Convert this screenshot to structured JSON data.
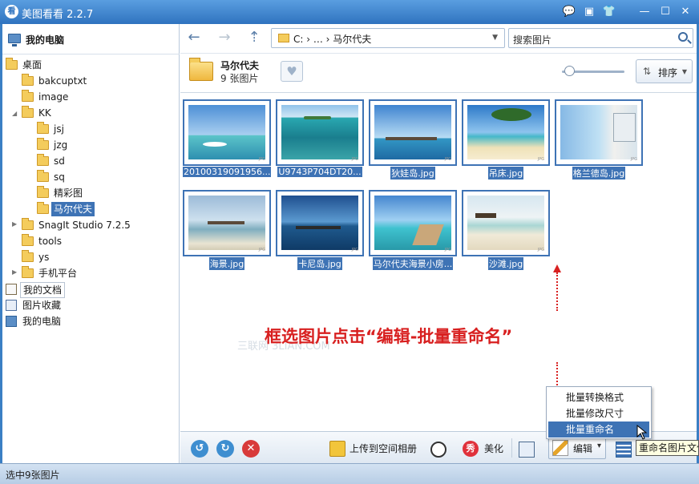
{
  "window": {
    "logo_char": "看",
    "title": "美图看看 2.2.7",
    "buttons": [
      "💬",
      "▣",
      "👕",
      "—",
      "☐",
      "✕"
    ]
  },
  "tree": {
    "header": "我的电脑",
    "items": [
      {
        "label": "桌面",
        "level": 0
      },
      {
        "label": "bakcuptxt",
        "level": 1
      },
      {
        "label": "image",
        "level": 1
      },
      {
        "label": "KK",
        "level": 1
      },
      {
        "label": "jsj",
        "level": 2
      },
      {
        "label": "jzg",
        "level": 2
      },
      {
        "label": "sd",
        "level": 2
      },
      {
        "label": "sq",
        "level": 2
      },
      {
        "label": "精彩图",
        "level": 2
      },
      {
        "label": "马尔代夫",
        "level": 2,
        "selected": true
      },
      {
        "label": "SnagIt Studio 7.2.5",
        "level": 1
      },
      {
        "label": "tools",
        "level": 1
      },
      {
        "label": "ys",
        "level": 1
      },
      {
        "label": "手机平台",
        "level": 1
      },
      {
        "label": "我的文档",
        "level": 0
      },
      {
        "label": "图片收藏",
        "level": 0
      },
      {
        "label": "我的电脑",
        "level": 0
      }
    ]
  },
  "nav": {
    "back": "←",
    "forward": "→",
    "up": "⇡",
    "address": "C:  ›  …  ›  马尔代夫",
    "search_placeholder": "搜索图片"
  },
  "folder": {
    "name": "马尔代夫",
    "count": "9 张图片",
    "heart": "♥",
    "sort_icon": "⇅",
    "sort_label": "排序",
    "zoom_level": 0.05
  },
  "thumbnails": [
    {
      "caption": "20100319091956...",
      "tag": "JPG"
    },
    {
      "caption": "U9743P704DT20...",
      "tag": "JPG"
    },
    {
      "caption": "狄娃岛.jpg",
      "tag": "JPG"
    },
    {
      "caption": "吊床.jpg",
      "tag": "JPG"
    },
    {
      "caption": "格兰德岛.jpg",
      "tag": "JPG"
    },
    {
      "caption": "海景.jpg",
      "tag": "JPG"
    },
    {
      "caption": "卡尼岛.jpg",
      "tag": "JPG"
    },
    {
      "caption": "马尔代夫海景小房...",
      "tag": "JPG"
    },
    {
      "caption": "沙滩.jpg",
      "tag": "JPG"
    }
  ],
  "annotation": {
    "instruction": "框选图片点击“编辑-批量重命名”",
    "watermark": "三联网 3LIAN.COM"
  },
  "menu": {
    "items": [
      "批量转换格式",
      "批量修改尺寸",
      "批量重命名"
    ],
    "highlighted_index": 2
  },
  "tooltip": "重命名图片文件",
  "bottom": {
    "rotate_left": "↺",
    "rotate_right": "↻",
    "delete": "✕",
    "upload": "上传到空间相册",
    "beautify_badge": "秀",
    "beautify": "美化",
    "edit": "编辑",
    "edit_arrow": "▾"
  },
  "status": "选中9张图片"
}
